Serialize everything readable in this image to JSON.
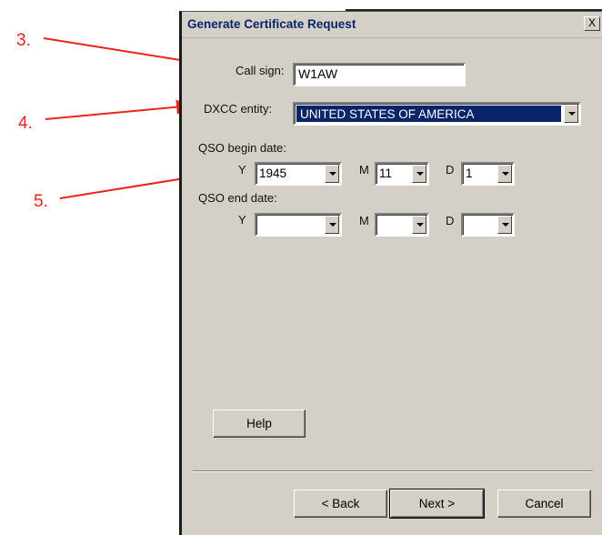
{
  "annotations": {
    "step3": "3.",
    "step4": "4.",
    "step5": "5."
  },
  "dialog": {
    "title": "Generate Certificate Request",
    "close_label": "X",
    "call_sign": {
      "label": "Call sign:",
      "value": "W1AW"
    },
    "dxcc": {
      "label": "DXCC entity:",
      "value": "UNITED STATES OF AMERICA"
    },
    "begin": {
      "label": "QSO begin date:",
      "y_label": "Y",
      "y_value": "1945",
      "m_label": "M",
      "m_value": "11",
      "d_label": "D",
      "d_value": "1"
    },
    "end": {
      "label": "QSO end date:",
      "y_label": "Y",
      "y_value": "",
      "m_label": "M",
      "m_value": "",
      "d_label": "D",
      "d_value": ""
    },
    "buttons": {
      "help": "Help",
      "back": "< Back",
      "next": "Next >",
      "cancel": "Cancel"
    }
  },
  "colors": {
    "annotation": "#e8251c",
    "selection": "#0a246a",
    "face": "#d4d0c8"
  }
}
